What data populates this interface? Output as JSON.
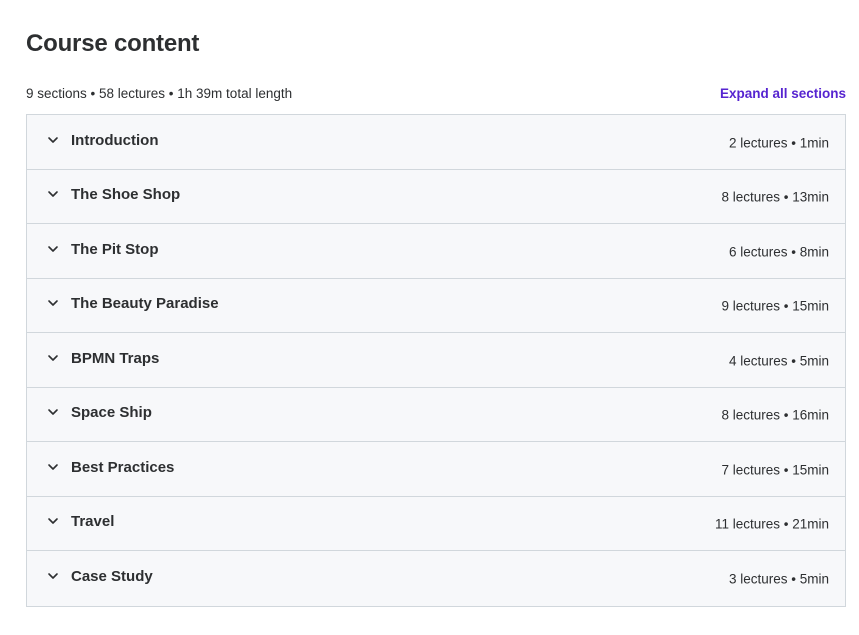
{
  "header": {
    "title": "Course content",
    "summary": "9 sections • 58 lectures • 1h 39m total length",
    "expand_all_label": "Expand all sections"
  },
  "colors": {
    "accent": "#5624d0",
    "text": "#2d2f31",
    "section_bg": "#f7f8fa",
    "border": "#d1d7dc"
  },
  "sections": [
    {
      "title": "Introduction",
      "meta": "2 lectures • 1min",
      "icon": "chevron-down-icon"
    },
    {
      "title": "The Shoe Shop",
      "meta": "8 lectures • 13min",
      "icon": "chevron-down-icon"
    },
    {
      "title": "The Pit Stop",
      "meta": "6 lectures • 8min",
      "icon": "chevron-down-icon"
    },
    {
      "title": "The Beauty Paradise",
      "meta": "9 lectures • 15min",
      "icon": "chevron-down-icon"
    },
    {
      "title": "BPMN Traps",
      "meta": "4 lectures • 5min",
      "icon": "chevron-down-icon"
    },
    {
      "title": "Space Ship",
      "meta": "8 lectures • 16min",
      "icon": "chevron-down-icon"
    },
    {
      "title": "Best Practices",
      "meta": "7 lectures • 15min",
      "icon": "chevron-down-icon"
    },
    {
      "title": "Travel",
      "meta": "11 lectures • 21min",
      "icon": "chevron-down-icon"
    },
    {
      "title": "Case Study",
      "meta": "3 lectures • 5min",
      "icon": "chevron-down-icon"
    }
  ]
}
